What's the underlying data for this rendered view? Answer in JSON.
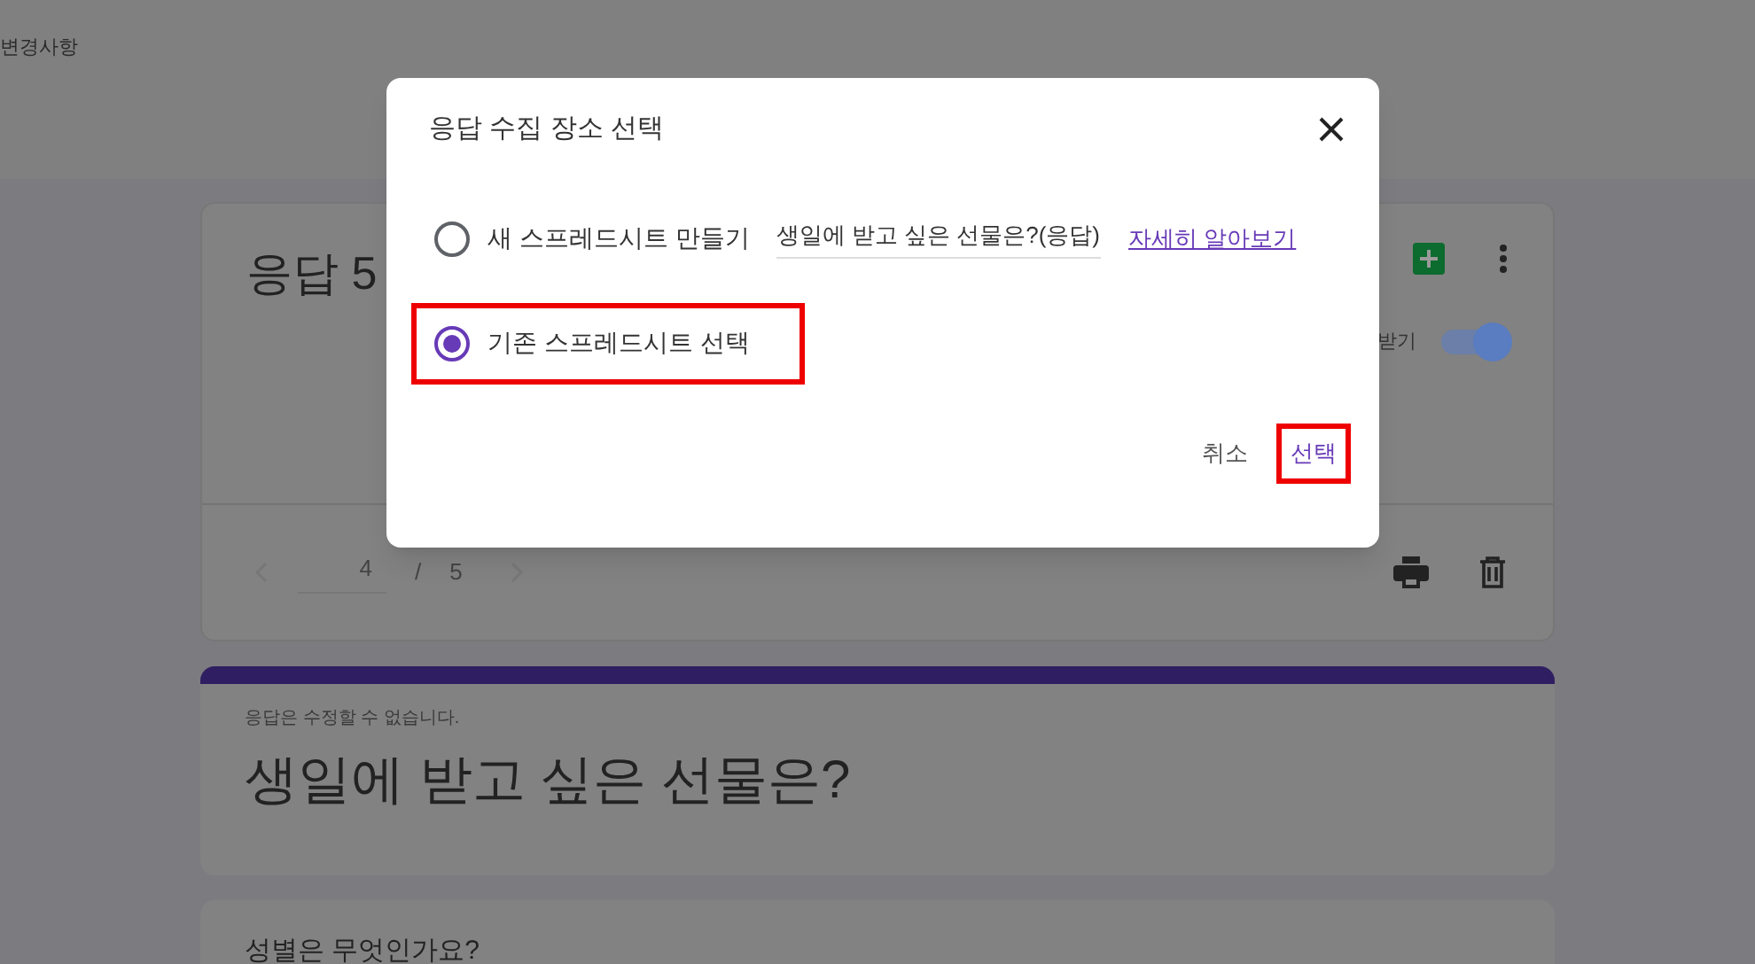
{
  "header": {
    "text": "변경사항"
  },
  "summary_card": {
    "title": "응답 5",
    "toggle": {
      "label": "받기",
      "on": true
    },
    "pager": {
      "current": "4",
      "separator": "/",
      "total": "5"
    }
  },
  "form_card": {
    "note": "응답은 수정할 수 없습니다.",
    "title": "생일에 받고 싶은 선물은?"
  },
  "question_card": {
    "title": "성별은 무엇인가요?"
  },
  "dialog": {
    "title": "응답 수집 장소 선택",
    "options": [
      {
        "kind": "new",
        "label": "새 스프레드시트 만들기",
        "selected": false,
        "highlighted": false,
        "value": "생일에 받고 싶은 선물은?(응답)",
        "link": "자세히 알아보기"
      },
      {
        "kind": "existing",
        "label": "기존 스프레드시트 선택",
        "selected": true,
        "highlighted": true
      }
    ],
    "cancel": "취소",
    "confirm": {
      "label": "선택",
      "highlighted": true
    }
  }
}
